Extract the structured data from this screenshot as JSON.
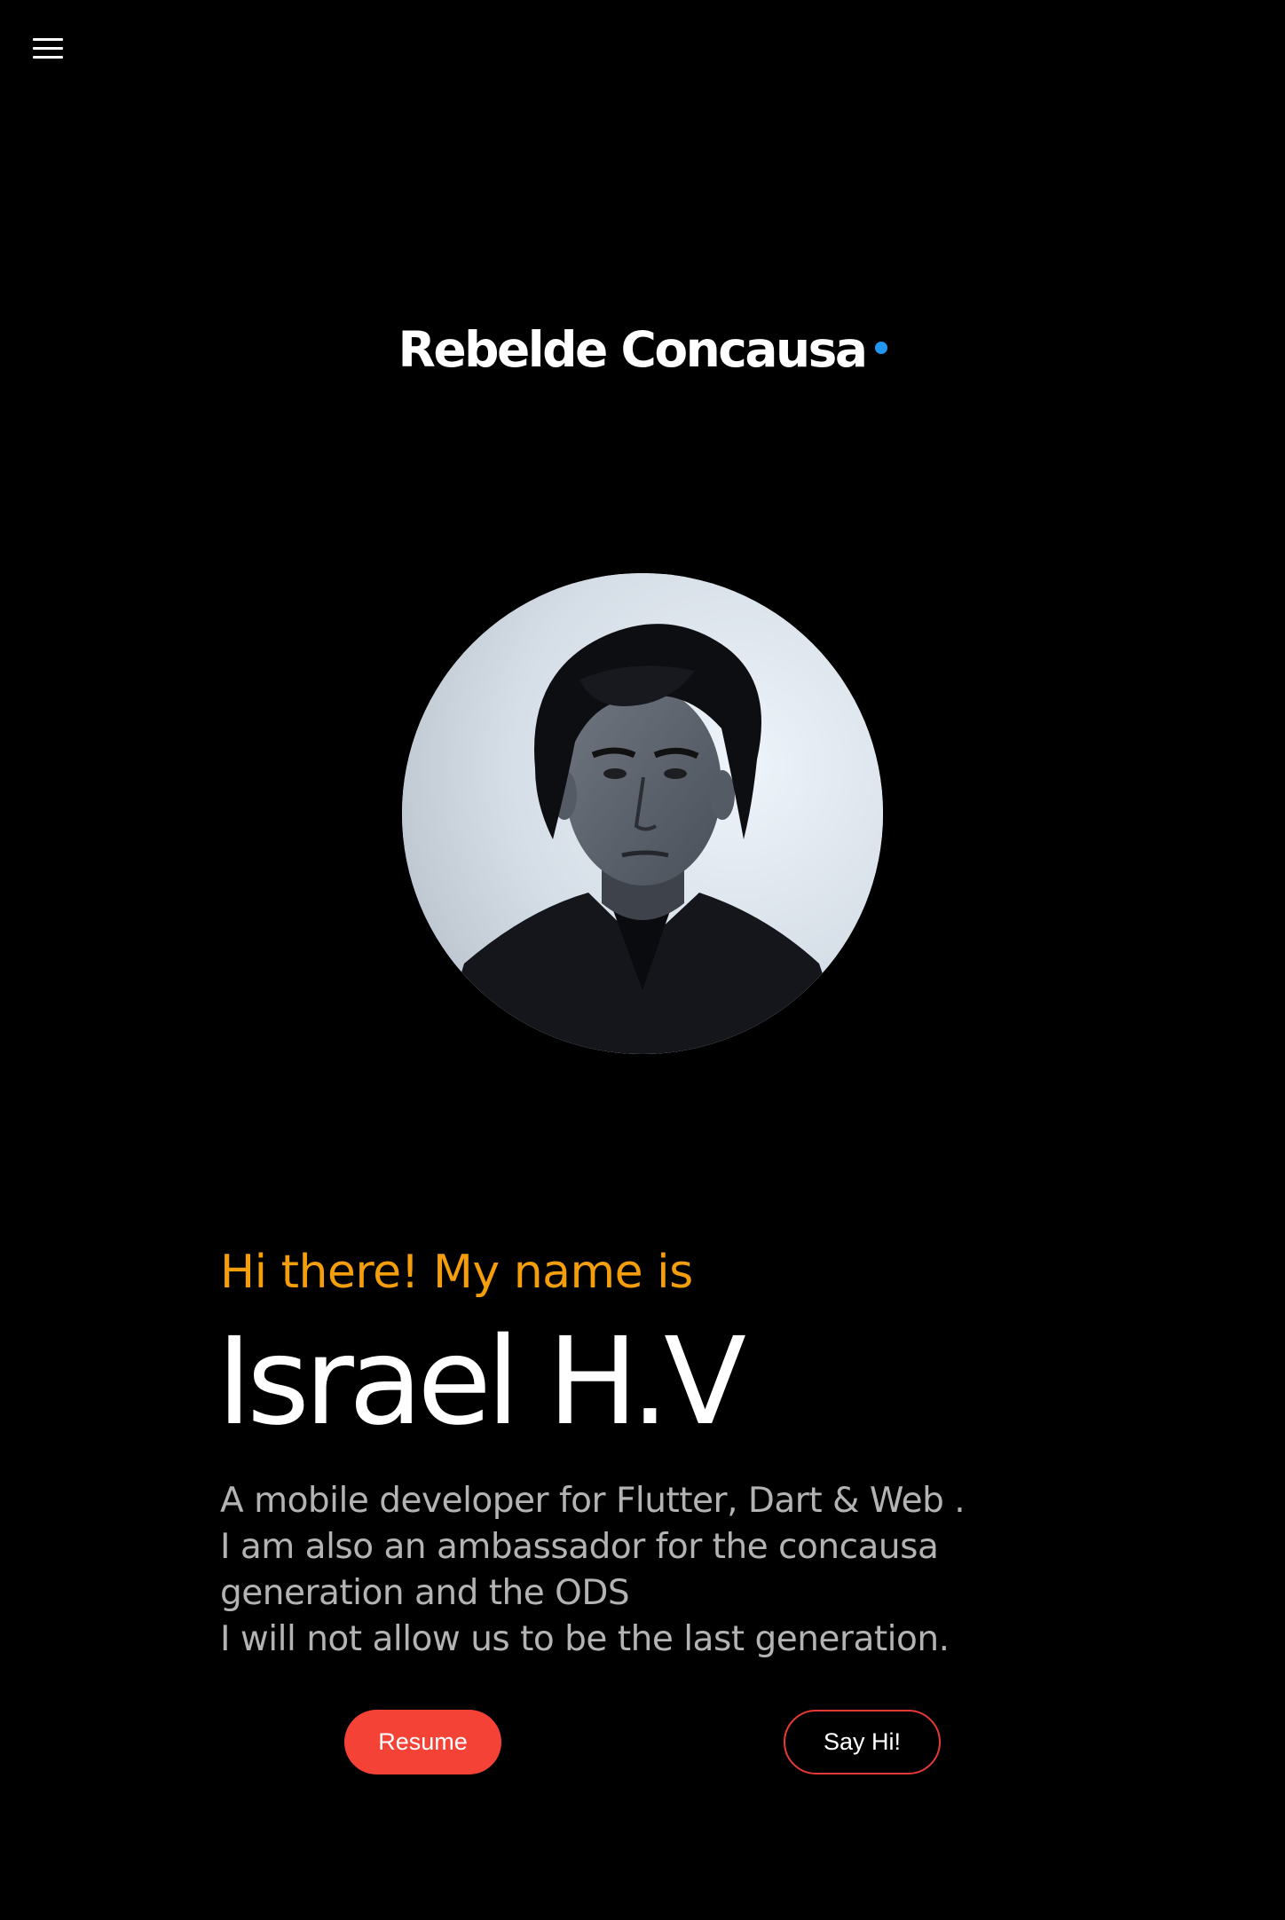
{
  "header": {
    "menu_icon": "hamburger-menu-icon"
  },
  "brand": {
    "name": "Rebelde Concausa",
    "dot_color": "#2196f3"
  },
  "profile": {
    "photo": "profile-photo"
  },
  "intro": {
    "greeting": "Hi there! My name is",
    "name": "Israel H.V",
    "bio_lines": [
      "A mobile developer for Flutter, Dart & Web .",
      "I am also an ambassador for the concausa",
      "generation and the ODS",
      "I will not allow us to be the last generation."
    ]
  },
  "actions": {
    "resume_label": "Resume",
    "say_hi_label": "Say Hi!"
  },
  "colors": {
    "background": "#000000",
    "greeting": "#f59e0b",
    "primary_button": "#f44336",
    "outline_button": "#e53935",
    "bio_text": "#b3b3b3"
  }
}
